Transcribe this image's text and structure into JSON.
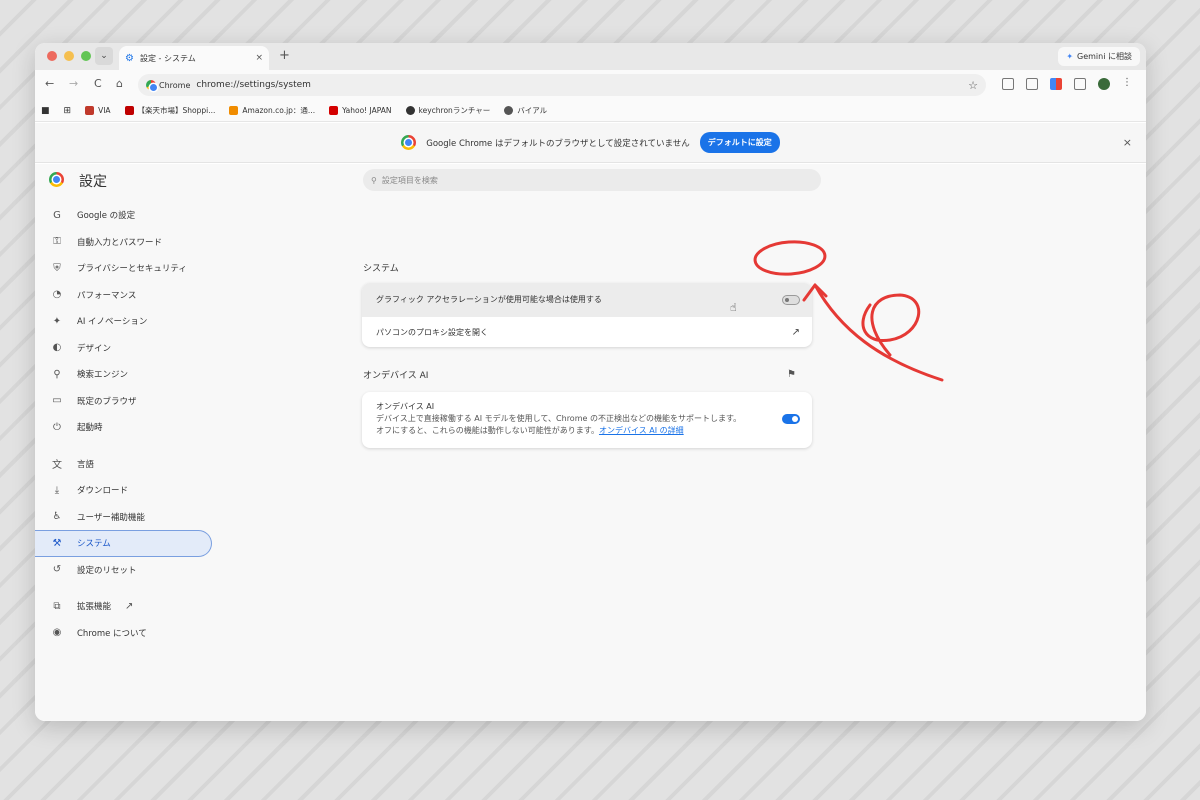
{
  "window": {
    "tab_title": "設定 - システム",
    "new_tab": "+",
    "tab_close": "×",
    "gemini_label": "Gemini に相談"
  },
  "toolbar": {
    "back": "←",
    "forward": "→",
    "reload": "C",
    "home": "⌂",
    "chip_label": "Chrome",
    "url": "chrome://settings/system",
    "star": "☆",
    "more": "⋮"
  },
  "bookmarks": [
    {
      "label": "VIA",
      "color": "#c0392b"
    },
    {
      "label": "【楽天市場】Shoppi...",
      "color": "#bf0000"
    },
    {
      "label": "Amazon.co.jp：通...",
      "color": "#f08c00"
    },
    {
      "label": "Yahoo! JAPAN",
      "color": "#d40000"
    },
    {
      "label": "keychronランチャー",
      "color": "#333333"
    },
    {
      "label": "バイアル",
      "color": "#555555"
    }
  ],
  "infobar": {
    "message": "Google Chrome はデフォルトのブラウザとして設定されていません",
    "button": "デフォルトに設定",
    "close": "×"
  },
  "settings": {
    "title": "設定",
    "search_placeholder": "設定項目を検索"
  },
  "sidebar": {
    "items": [
      {
        "label": "Google の設定",
        "icon": "google-icon",
        "glyph": "G"
      },
      {
        "label": "自動入力とパスワード",
        "icon": "key-icon",
        "glyph": "⚿"
      },
      {
        "label": "プライバシーとセキュリティ",
        "icon": "shield-icon",
        "glyph": "⛨"
      },
      {
        "label": "パフォーマンス",
        "icon": "speedometer-icon",
        "glyph": "◔"
      },
      {
        "label": "AI イノベーション",
        "icon": "sparkle-icon",
        "glyph": "✦"
      },
      {
        "label": "デザイン",
        "icon": "palette-icon",
        "glyph": "◐"
      },
      {
        "label": "検索エンジン",
        "icon": "search-icon",
        "glyph": "⚲"
      },
      {
        "label": "既定のブラウザ",
        "icon": "browser-icon",
        "glyph": "▭"
      },
      {
        "label": "起動時",
        "icon": "power-icon",
        "glyph": "⏻"
      },
      {
        "label": "言語",
        "icon": "translate-icon",
        "glyph": "文"
      },
      {
        "label": "ダウンロード",
        "icon": "download-icon",
        "glyph": "⤓"
      },
      {
        "label": "ユーザー補助機能",
        "icon": "accessibility-icon",
        "glyph": "♿"
      },
      {
        "label": "システム",
        "icon": "wrench-icon",
        "glyph": "⚒"
      },
      {
        "label": "設定のリセット",
        "icon": "reset-icon",
        "glyph": "↺"
      },
      {
        "label": "拡張機能",
        "icon": "puzzle-icon",
        "glyph": "⧉"
      },
      {
        "label": "Chrome について",
        "icon": "chrome-icon",
        "glyph": "◉"
      }
    ],
    "active": "システム"
  },
  "content": {
    "system_section": "システム",
    "graphics_accel": "グラフィック アクセラレーションが使用可能な場合は使用する",
    "graphics_accel_on": false,
    "proxy": "パソコンのプロキシ設定を開く",
    "ondevice_section": "オンデバイス AI",
    "ondevice_title": "オンデバイス AI",
    "ondevice_desc1": "デバイス上で直接稼働する AI モデルを使用して、Chrome の不正検出などの機能をサポートします。",
    "ondevice_desc2": "オフにすると、これらの機能は動作しない可能性があります。",
    "ondevice_link": "オンデバイス AI の詳細",
    "ondevice_on": true
  },
  "colors": {
    "accent": "#1a73e8",
    "annotation": "#e53935"
  }
}
